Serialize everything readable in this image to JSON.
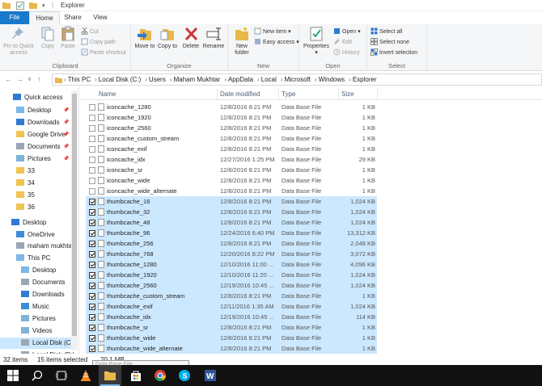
{
  "window": {
    "title": "Explorer"
  },
  "tabs": {
    "file": "File",
    "home": "Home",
    "share": "Share",
    "view": "View"
  },
  "ribbon": {
    "clipboard": {
      "label": "Clipboard",
      "pin": "Pin to Quick access",
      "copy": "Copy",
      "paste": "Paste",
      "cut": "Cut",
      "copy_path": "Copy path",
      "paste_shortcut": "Paste shortcut"
    },
    "organize": {
      "label": "Organize",
      "move_to": "Move to",
      "copy_to": "Copy to",
      "delete": "Delete",
      "rename": "Rename"
    },
    "new": {
      "label": "New",
      "new_folder": "New folder",
      "new_item": "New item",
      "easy_access": "Easy access"
    },
    "open": {
      "label": "Open",
      "properties": "Properties",
      "open": "Open",
      "edit": "Edit",
      "history": "History"
    },
    "select": {
      "label": "Select",
      "select_all": "Select all",
      "select_none": "Select none",
      "invert": "Invert selection"
    }
  },
  "breadcrumbs": [
    "This PC",
    "Local Disk (C:)",
    "Users",
    "Maham Mukhtar",
    "AppData",
    "Local",
    "Microsoft",
    "Windows",
    "Explorer"
  ],
  "nav": {
    "quick_access": "Quick access",
    "items": [
      {
        "label": "Desktop",
        "pinned": true
      },
      {
        "label": "Downloads",
        "pinned": true
      },
      {
        "label": "Google Drive",
        "pinned": true
      },
      {
        "label": "Documents",
        "pinned": true
      },
      {
        "label": "Pictures",
        "pinned": true
      },
      {
        "label": "33"
      },
      {
        "label": "34"
      },
      {
        "label": "35"
      },
      {
        "label": "36"
      }
    ],
    "desktop": "Desktop",
    "onedrive": "OneDrive",
    "user": "maham mukhta",
    "this_pc": "This PC",
    "pc_items": [
      "Desktop",
      "Documents",
      "Downloads",
      "Music",
      "Pictures",
      "Videos",
      "Local Disk (C:)",
      "Local Disk (D:)"
    ]
  },
  "columns": {
    "name": "Name",
    "date": "Date modified",
    "type": "Type",
    "size": "Size"
  },
  "files": [
    {
      "name": "iconcache_1280",
      "date": "12/8/2016 8:21 PM",
      "type": "Data Base File",
      "size": "1 KB",
      "selected": false
    },
    {
      "name": "iconcache_1920",
      "date": "12/8/2016 8:21 PM",
      "type": "Data Base File",
      "size": "1 KB",
      "selected": false
    },
    {
      "name": "iconcache_2560",
      "date": "12/8/2016 8:21 PM",
      "type": "Data Base File",
      "size": "1 KB",
      "selected": false
    },
    {
      "name": "iconcache_custom_stream",
      "date": "12/8/2016 8:21 PM",
      "type": "Data Base File",
      "size": "1 KB",
      "selected": false
    },
    {
      "name": "iconcache_exif",
      "date": "12/8/2016 8:21 PM",
      "type": "Data Base File",
      "size": "1 KB",
      "selected": false
    },
    {
      "name": "iconcache_idx",
      "date": "12/27/2016 1:25 PM",
      "type": "Data Base File",
      "size": "29 KB",
      "selected": false
    },
    {
      "name": "iconcache_sr",
      "date": "12/8/2016 8:21 PM",
      "type": "Data Base File",
      "size": "1 KB",
      "selected": false
    },
    {
      "name": "iconcache_wide",
      "date": "12/8/2016 8:21 PM",
      "type": "Data Base File",
      "size": "1 KB",
      "selected": false
    },
    {
      "name": "iconcache_wide_alternate",
      "date": "12/8/2016 8:21 PM",
      "type": "Data Base File",
      "size": "1 KB",
      "selected": false
    },
    {
      "name": "thumbcache_16",
      "date": "12/8/2016 8:21 PM",
      "type": "Data Base File",
      "size": "1,024 KB",
      "selected": true
    },
    {
      "name": "thumbcache_32",
      "date": "12/8/2016 8:21 PM",
      "type": "Data Base File",
      "size": "1,024 KB",
      "selected": true
    },
    {
      "name": "thumbcache_48",
      "date": "12/8/2016 8:21 PM",
      "type": "Data Base File",
      "size": "1,024 KB",
      "selected": true
    },
    {
      "name": "thumbcache_96",
      "date": "12/24/2016 6:40 PM",
      "type": "Data Base File",
      "size": "13,312 KB",
      "selected": true
    },
    {
      "name": "thumbcache_256",
      "date": "12/8/2016 8:21 PM",
      "type": "Data Base File",
      "size": "2,048 KB",
      "selected": true
    },
    {
      "name": "thumbcache_768",
      "date": "12/20/2016 8:22 PM",
      "type": "Data Base File",
      "size": "3,072 KB",
      "selected": true
    },
    {
      "name": "thumbcache_1280",
      "date": "12/10/2016 11:00 ...",
      "type": "Data Base File",
      "size": "4,096 KB",
      "selected": true
    },
    {
      "name": "thumbcache_1920",
      "date": "12/10/2016 11:20 ...",
      "type": "Data Base File",
      "size": "1,024 KB",
      "selected": true
    },
    {
      "name": "thumbcache_2560",
      "date": "12/19/2016 10:45 ...",
      "type": "Data Base File",
      "size": "1,024 KB",
      "selected": true
    },
    {
      "name": "thumbcache_custom_stream",
      "date": "12/8/2016 8:21 PM",
      "type": "Data Base File",
      "size": "1 KB",
      "selected": true
    },
    {
      "name": "thumbcache_exif",
      "date": "12/11/2016 1:35 AM",
      "type": "Data Base File",
      "size": "1,024 KB",
      "selected": true
    },
    {
      "name": "thumbcache_idx",
      "date": "12/19/2016 10:45 ...",
      "type": "Data Base File",
      "size": "114 KB",
      "selected": true
    },
    {
      "name": "thumbcache_sr",
      "date": "12/8/2016 8:21 PM",
      "type": "Data Base File",
      "size": "1 KB",
      "selected": true
    },
    {
      "name": "thumbcache_wide",
      "date": "12/8/2016 8:21 PM",
      "type": "Data Base File",
      "size": "1 KB",
      "selected": true
    },
    {
      "name": "thumbcache_wide_alternate",
      "date": "12/8/2016 8:21 PM",
      "type": "Data Base File",
      "size": "1 KB",
      "selected": true
    }
  ],
  "status": {
    "items": "32 items",
    "selected": "15 items selected",
    "size": "20.1 MB"
  },
  "tooltip": {
    "text": "Data Base File"
  },
  "colors": {
    "accent": "#1979ca",
    "selection": "#cce8ff",
    "taskbar": "#111111"
  }
}
